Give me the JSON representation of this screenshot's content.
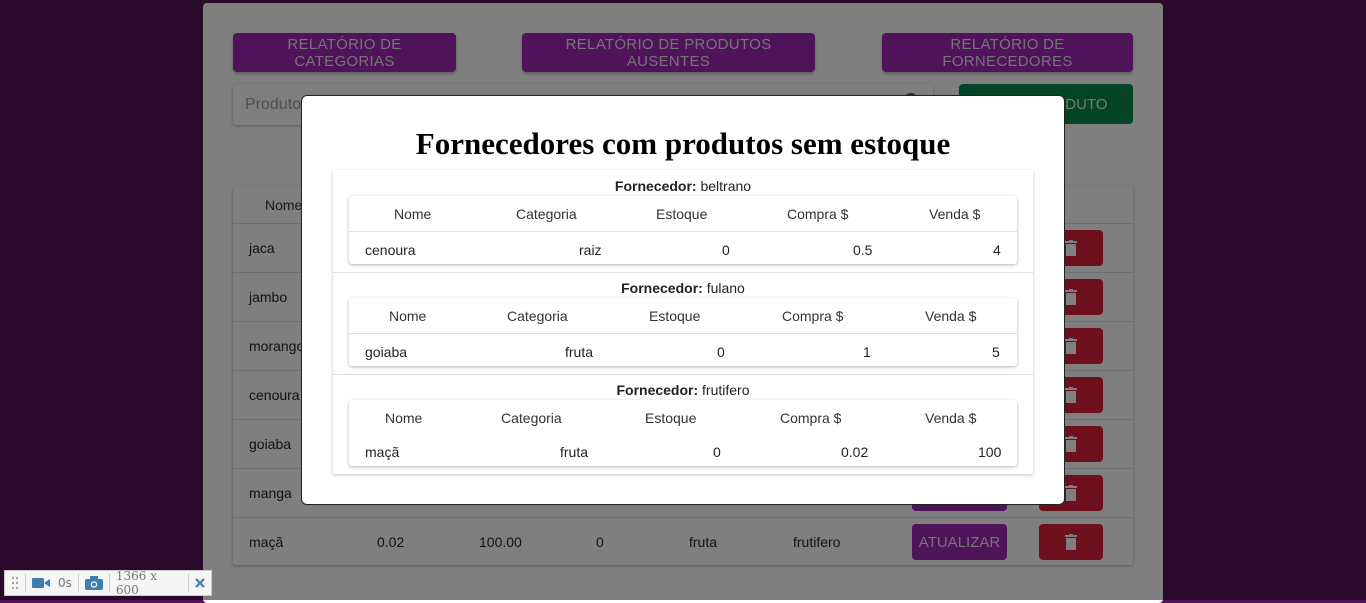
{
  "top_buttons": {
    "categories": "RELATÓRIO DE CATEGORIAS",
    "missing_products": "RELATÓRIO DE PRODUTOS AUSENTES",
    "suppliers": "RELATÓRIO DE FORNECEDORES"
  },
  "search": {
    "placeholder": "Produto"
  },
  "add_button": {
    "label": "NOVO PRODUTO"
  },
  "table": {
    "header_nome": "Nome",
    "rows": [
      {
        "nome": "jaca"
      },
      {
        "nome": "jambo"
      },
      {
        "nome": "morango"
      },
      {
        "nome": "cenoura"
      },
      {
        "nome": "goiaba"
      },
      {
        "nome": "manga"
      },
      {
        "nome": "maçã",
        "compra": "0.02",
        "venda": "100.00",
        "estoque": "0",
        "categoria": "fruta",
        "fornecedor": "frutifero"
      }
    ],
    "update_label": "ATUALIZAR"
  },
  "modal": {
    "title": "Fornecedores com produtos sem estoque",
    "supplier_prefix": "Fornecedor:",
    "columns": [
      "Nome",
      "Categoria",
      "Estoque",
      "Compra $",
      "Venda $"
    ],
    "suppliers": [
      {
        "name": "beltrano",
        "rows": [
          {
            "nome": "cenoura",
            "categoria": "raiz",
            "estoque": "0",
            "compra": "0.5",
            "venda": "4"
          }
        ]
      },
      {
        "name": "fulano",
        "rows": [
          {
            "nome": "goiaba",
            "categoria": "fruta",
            "estoque": "0",
            "compra": "1",
            "venda": "5"
          }
        ]
      },
      {
        "name": "frutifero",
        "rows": [
          {
            "nome": "maçã",
            "categoria": "fruta",
            "estoque": "0",
            "compra": "0.02",
            "venda": "100"
          }
        ]
      }
    ]
  },
  "devbar": {
    "time": "0s",
    "size": "1366 x 600"
  },
  "icons": {
    "trash": "trash-icon",
    "search": "search-icon",
    "video": "video-icon",
    "camera": "camera-icon",
    "close": "close-icon",
    "grip": "grip-icon"
  },
  "colors": {
    "background": "#521457",
    "primary": "#9c27b0",
    "success": "#0a8a4f",
    "danger": "#dc1f3c"
  }
}
